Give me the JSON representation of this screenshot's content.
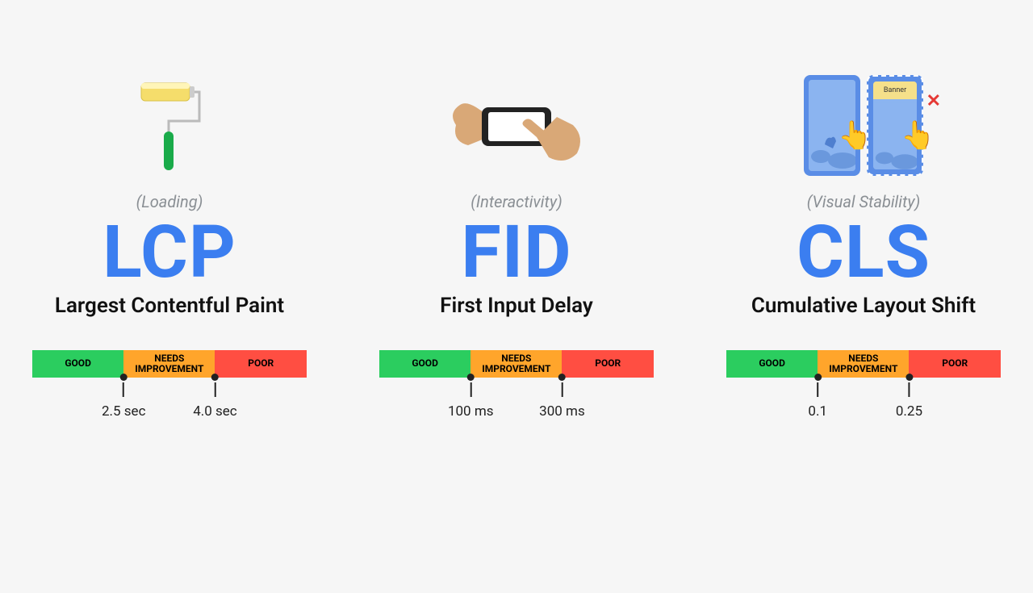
{
  "metrics": [
    {
      "category": "(Loading)",
      "acronym": "LCP",
      "fullname": "Largest Contentful Paint",
      "thresholds": {
        "t1": "2.5 sec",
        "t2": "4.0 sec"
      }
    },
    {
      "category": "(Interactivity)",
      "acronym": "FID",
      "fullname": "First Input Delay",
      "thresholds": {
        "t1": "100 ms",
        "t2": "300 ms"
      }
    },
    {
      "category": "(Visual Stability)",
      "acronym": "CLS",
      "fullname": "Cumulative Layout Shift",
      "thresholds": {
        "t1": "0.1",
        "t2": "0.25"
      }
    }
  ],
  "scale": {
    "good": "GOOD",
    "needs_line1": "NEEDS",
    "needs_line2": "IMPROVEMENT",
    "poor": "POOR"
  },
  "cls_illustration": {
    "banner_label": "Banner",
    "x_mark": "✕"
  }
}
